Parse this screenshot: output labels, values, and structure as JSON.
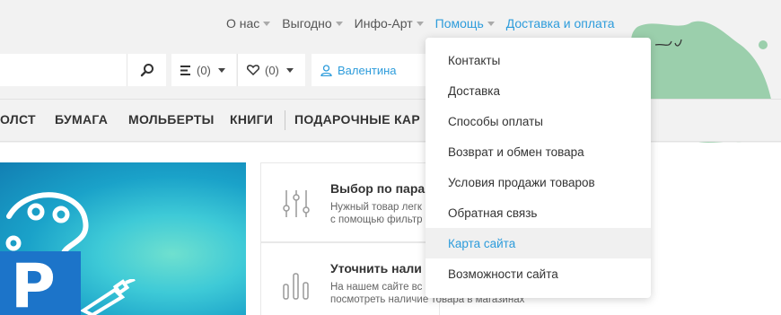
{
  "topnav": {
    "items": [
      {
        "label": "О нас"
      },
      {
        "label": "Выгодно"
      },
      {
        "label": "Инфо-Арт"
      },
      {
        "label": "Помощь"
      },
      {
        "label": "Доставка и оплата"
      }
    ]
  },
  "toolbar": {
    "list_count": "(0)",
    "wishlist_count": "(0)",
    "user_name": "Валентина"
  },
  "categories": [
    "ОЛСТ",
    "БУМАГА",
    "МОЛЬБЕРТЫ",
    "КНИГИ",
    "ПОДАРОЧНЫЕ КАР"
  ],
  "banner": {
    "logo_letter": "P"
  },
  "cards": [
    {
      "title": "Выбор по пара",
      "desc_line1": "Нужный товар легк",
      "desc_line2": "с помощью фильтр"
    },
    {
      "title": "Уточнить нали",
      "desc_line1": "На нашем сайте вс",
      "desc_line2": "посмотреть наличие товара в магазинах"
    }
  ],
  "help_menu": {
    "items": [
      {
        "label": "Контакты"
      },
      {
        "label": "Доставка"
      },
      {
        "label": "Способы оплаты"
      },
      {
        "label": "Возврат и обмен товара"
      },
      {
        "label": "Условия продажи товаров"
      },
      {
        "label": "Обратная связь"
      },
      {
        "label": "Карта сайта"
      },
      {
        "label": "Возможности сайта"
      }
    ]
  },
  "colors": {
    "accent": "#2d9cdb",
    "background": "#f2f2f2",
    "logo_blue": "#1c74c9",
    "splash_green": "#8cc9a0"
  }
}
